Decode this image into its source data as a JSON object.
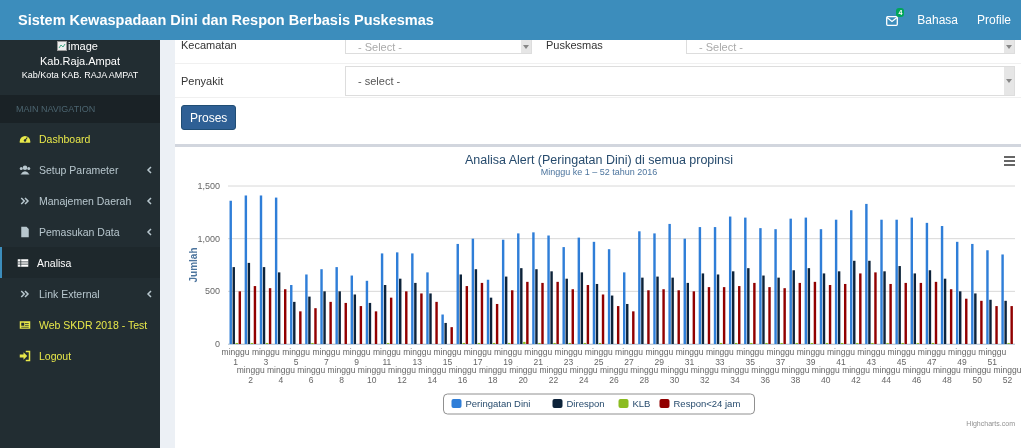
{
  "header": {
    "title": "Sistem Kewaspadaan Dini dan Respon Berbasis Puskesmas",
    "notification_count": "4",
    "links": [
      "Bahasa",
      "Profile"
    ]
  },
  "sidebar": {
    "image_alt": "image",
    "name": "Kab.Raja.Ampat",
    "subtitle": "Kab/Kota KAB. RAJA AMPAT",
    "section": "MAIN NAVIGATION",
    "items": [
      {
        "label": "Dashboard",
        "kind": "dashboard",
        "highlighted": true,
        "expandable": false,
        "selected": false
      },
      {
        "label": "Setup Parameter",
        "kind": "users",
        "highlighted": false,
        "expandable": true,
        "selected": false
      },
      {
        "label": "Manajemen Daerah",
        "kind": "chevrons",
        "highlighted": false,
        "expandable": true,
        "selected": false
      },
      {
        "label": "Pemasukan Data",
        "kind": "file",
        "highlighted": false,
        "expandable": true,
        "selected": false
      },
      {
        "label": "Analisa",
        "kind": "table",
        "highlighted": false,
        "expandable": false,
        "selected": true
      },
      {
        "label": "Link External",
        "kind": "chevrons",
        "highlighted": false,
        "expandable": true,
        "selected": false
      },
      {
        "label": "Web SKDR 2018 - Test",
        "kind": "card",
        "highlighted": true,
        "expandable": false,
        "selected": false
      },
      {
        "label": "Logout",
        "kind": "signin",
        "highlighted": true,
        "expandable": false,
        "selected": false
      }
    ]
  },
  "form": {
    "rows": [
      {
        "fields": [
          {
            "label": "Kecamatan",
            "placeholder": "- Select -"
          },
          {
            "label": "Puskesmas",
            "placeholder": "- Select -"
          }
        ]
      },
      {
        "fields": [
          {
            "label": "Penyakit",
            "placeholder": "- select -"
          }
        ]
      }
    ],
    "button": "Proses"
  },
  "chart": {
    "credit": "Highcharts.com",
    "chart_data": {
      "type": "bar",
      "orientation": "vertical",
      "legend": "bottom",
      "title": "Analisa Alert (Peringatan Dini) di semua propinsi",
      "subtitle": "Minggu ke 1 – 52 tahun 2016",
      "ylabel": "Jumlah",
      "ylim": [
        0,
        1500
      ],
      "yticks": [
        {
          "value": 0,
          "label": "0"
        },
        {
          "value": 500,
          "label": "500"
        },
        {
          "value": 1000,
          "label": "1,000"
        },
        {
          "value": 1500,
          "label": "1,500"
        }
      ],
      "categories": [
        "minggu 1",
        "minggu 2",
        "minggu 3",
        "minggu 4",
        "minggu 5",
        "minggu 6",
        "minggu 7",
        "minggu 8",
        "minggu 9",
        "minggu 10",
        "minggu 11",
        "minggu 12",
        "minggu 13",
        "minggu 14",
        "minggu 15",
        "minggu 16",
        "minggu 17",
        "minggu 18",
        "minggu 19",
        "minggu 20",
        "minggu 21",
        "minggu 22",
        "minggu 23",
        "minggu 24",
        "minggu 25",
        "minggu 26",
        "minggu 27",
        "minggu 28",
        "minggu 29",
        "minggu 30",
        "minggu 31",
        "minggu 32",
        "minggu 33",
        "minggu 34",
        "minggu 35",
        "minggu 36",
        "minggu 37",
        "minggu 38",
        "minggu 39",
        "minggu 40",
        "minggu 41",
        "minggu 42",
        "minggu 43",
        "minggu 44",
        "minggu 45",
        "minggu 46",
        "minggu 47",
        "minggu 48",
        "minggu 49",
        "minggu 50",
        "minggu 51",
        "minggu 52"
      ],
      "series": [
        {
          "name": "Peringatan Dini",
          "color": "#2f7ed8",
          "values": [
            1360,
            1410,
            1410,
            1390,
            560,
            660,
            710,
            730,
            650,
            600,
            860,
            870,
            860,
            680,
            280,
            950,
            1000,
            610,
            990,
            1050,
            1060,
            1030,
            920,
            1010,
            970,
            900,
            680,
            1070,
            1050,
            1140,
            1000,
            1110,
            1110,
            1210,
            1200,
            1100,
            1090,
            1190,
            1200,
            1090,
            1180,
            1270,
            1330,
            1180,
            1180,
            1200,
            1150,
            1120,
            970,
            950,
            890,
            850
          ]
        },
        {
          "name": "Direspon",
          "color": "#0d233a",
          "values": [
            730,
            770,
            730,
            680,
            400,
            450,
            500,
            500,
            470,
            390,
            560,
            620,
            580,
            480,
            200,
            660,
            710,
            440,
            640,
            720,
            710,
            690,
            620,
            680,
            570,
            460,
            380,
            630,
            640,
            630,
            580,
            670,
            660,
            690,
            720,
            650,
            630,
            700,
            720,
            670,
            690,
            790,
            790,
            690,
            740,
            670,
            700,
            620,
            500,
            480,
            420,
            410
          ]
        },
        {
          "name": "KLB",
          "color": "#8bbc21",
          "values": [
            10,
            10,
            10,
            0,
            0,
            10,
            0,
            0,
            0,
            0,
            10,
            0,
            0,
            0,
            0,
            10,
            10,
            10,
            10,
            20,
            10,
            10,
            10,
            10,
            10,
            0,
            0,
            0,
            0,
            0,
            0,
            0,
            10,
            10,
            10,
            10,
            10,
            10,
            10,
            10,
            10,
            10,
            10,
            10,
            10,
            10,
            10,
            0,
            0,
            0,
            0,
            10
          ]
        },
        {
          "name": "Respon<24 jam",
          "color": "#910000",
          "values": [
            500,
            550,
            530,
            520,
            310,
            340,
            400,
            390,
            360,
            310,
            440,
            500,
            480,
            400,
            160,
            550,
            580,
            380,
            510,
            590,
            580,
            590,
            520,
            560,
            470,
            360,
            310,
            510,
            520,
            510,
            500,
            540,
            540,
            550,
            580,
            540,
            530,
            580,
            590,
            560,
            570,
            670,
            680,
            570,
            580,
            580,
            590,
            520,
            430,
            410,
            360,
            360
          ]
        }
      ]
    }
  }
}
